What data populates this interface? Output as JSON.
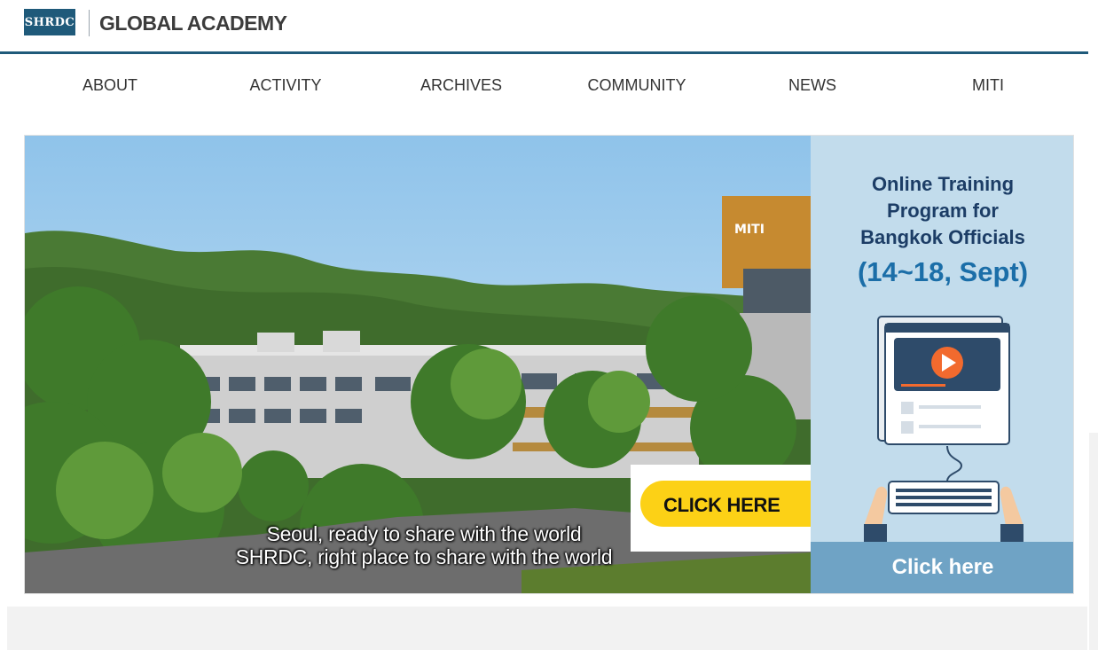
{
  "header": {
    "logo_text": "SHRDC",
    "brand": "GLOBAL ACADEMY",
    "accent_color": "#1f5a7a"
  },
  "nav": {
    "items": [
      {
        "label": "ABOUT"
      },
      {
        "label": "ACTIVITY"
      },
      {
        "label": "ARCHIVES"
      },
      {
        "label": "COMMUNITY"
      },
      {
        "label": "NEWS"
      },
      {
        "label": "MITI"
      }
    ]
  },
  "hero": {
    "caption_line1": "Seoul, ready to share with the world",
    "caption_line2": "SHRDC, right place to share with the world",
    "building_sign": "MITI",
    "click_here_pill": "CLICK HERE"
  },
  "promo": {
    "title_line1": "Online Training",
    "title_line2": "Program for",
    "title_line3": "Bangkok Officials",
    "dates": "(14~18, Sept)",
    "button_label": "Click here",
    "background_color": "#c2dcec",
    "button_color": "#6fa3c5"
  },
  "icons": {
    "play": "play-icon",
    "hand": "hand-pointer-icon"
  }
}
